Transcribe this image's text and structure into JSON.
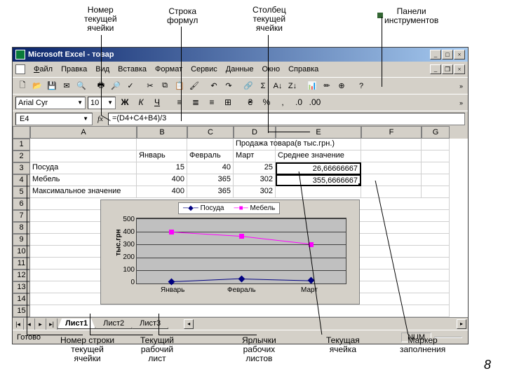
{
  "annotations": {
    "top1": "Номер\nтекущей\nячейки",
    "top2": "Строка\nформул",
    "top3": "Столбец\nтекущей\nячейки",
    "top4": "Панели\nинструментов",
    "bot1": "Номер строки\nтекущей\nячейки",
    "bot2": "Текущий\nрабочий\nлист",
    "bot3": "Ярлычки\nрабочих\nлистов",
    "bot4": "Текущая\nячейка",
    "bot5": "Маркер\nзаполнения"
  },
  "title": "Microsoft Excel - товар",
  "menu": {
    "file": "Файл",
    "edit": "Правка",
    "view": "Вид",
    "insert": "Вставка",
    "format": "Формат",
    "tools": "Сервис",
    "data": "Данные",
    "window": "Окно",
    "help": "Справка"
  },
  "font": {
    "name": "Arial Cyr",
    "size": "10"
  },
  "namebox": "E4",
  "formula": "=(D4+C4+B4)/3",
  "cols": [
    "A",
    "B",
    "C",
    "D",
    "E",
    "F",
    "G"
  ],
  "rows": [
    "1",
    "2",
    "3",
    "4",
    "5",
    "6",
    "7",
    "8",
    "9",
    "10",
    "11",
    "12",
    "13",
    "14",
    "15"
  ],
  "data": {
    "r1": {
      "D": "Продажа товара(в тыс.грн.)"
    },
    "r2": {
      "B": "Январь",
      "C": "Февраль",
      "D": "Март",
      "E": "Среднее значение"
    },
    "r3": {
      "A": "Посуда",
      "B": "15",
      "C": "40",
      "D": "25",
      "E": "26,66666667"
    },
    "r4": {
      "A": "Мебель",
      "B": "400",
      "C": "365",
      "D": "302",
      "E": "355,6666667"
    },
    "r5": {
      "A": "Максимальное значение",
      "B": "400",
      "C": "365",
      "D": "302"
    }
  },
  "chart_data": {
    "type": "line",
    "categories": [
      "Январь",
      "Февраль",
      "Март"
    ],
    "series": [
      {
        "name": "Посуда",
        "values": [
          15,
          40,
          25
        ],
        "color": "#000080",
        "marker": "diamond"
      },
      {
        "name": "Мебель",
        "values": [
          400,
          365,
          302
        ],
        "color": "#ff00ff",
        "marker": "square"
      }
    ],
    "ylabel": "тыс.грн",
    "ylim": [
      0,
      500
    ],
    "yticks": [
      0,
      100,
      200,
      300,
      400,
      500
    ]
  },
  "tabs": {
    "t1": "Лист1",
    "t2": "Лист2",
    "t3": "Лист3"
  },
  "status": {
    "ready": "Готово",
    "num": "NUM"
  },
  "page": "8"
}
